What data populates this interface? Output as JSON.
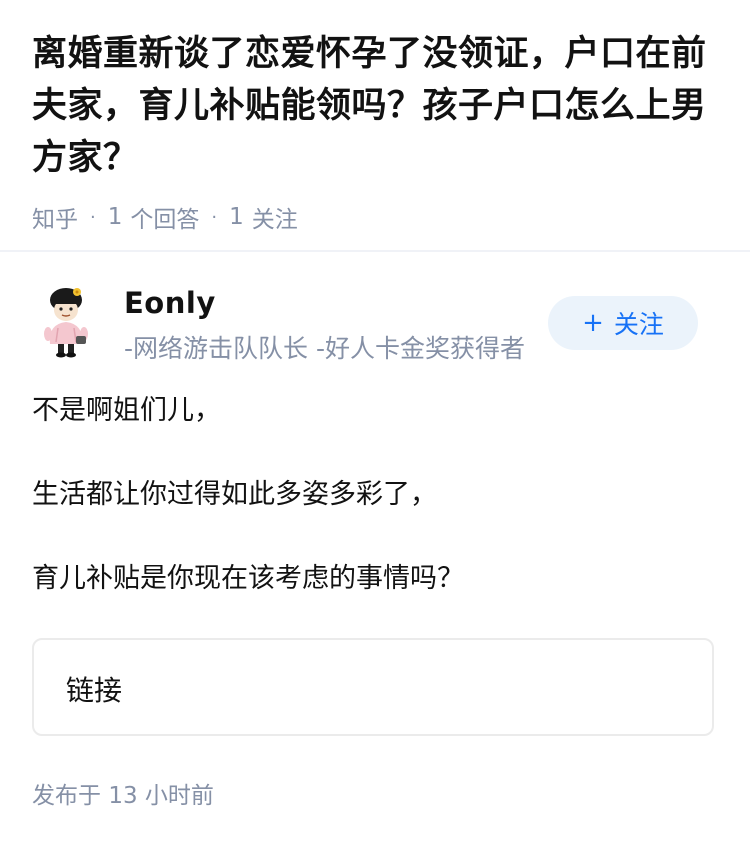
{
  "question": {
    "title": "离婚重新谈了恋爱怀孕了没领证，户口在前夫家，育儿补贴能领吗？孩子户口怎么上男方家？",
    "source": "知乎",
    "answers_count": "1",
    "answers_label": "个回答",
    "followers_count": "1",
    "followers_label": "关注"
  },
  "answer": {
    "author": {
      "name": "Eonly",
      "bio": "-网络游击队队长 -好人卡金奖获得者",
      "avatar_icon": "cartoon-avatar-icon"
    },
    "follow_button": {
      "plus": "+",
      "label": "关注"
    },
    "paragraphs": [
      "不是啊姐们儿，",
      "生活都让你过得如此多姿多彩了，",
      "育儿补贴是你现在该考虑的事情吗？"
    ],
    "link_card_label": "链接",
    "published_prefix": "发布于",
    "published_time": "13 小时前"
  },
  "colors": {
    "meta_gray": "#8590a6",
    "brand_blue": "#1772f6",
    "follow_bg": "#ebf3fb"
  }
}
